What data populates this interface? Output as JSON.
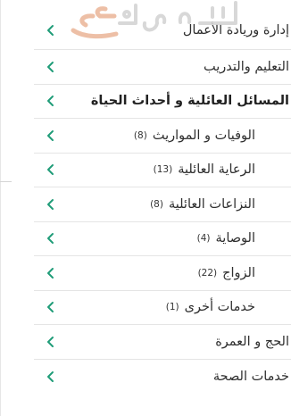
{
  "colors": {
    "chevron": "#1f9c78",
    "divider": "#e5e5e5",
    "text": "#2f2f2f",
    "watermark": "#d2d2d2"
  },
  "watermark_icon": "site-logo-watermark",
  "menu": [
    {
      "label": "إدارة وريادة الأعمال",
      "count": "",
      "level": "top",
      "bold": false
    },
    {
      "label": "التعليم والتدريب",
      "count": "",
      "level": "top",
      "bold": false
    },
    {
      "label": "المسائل العائلية و أحداث الحياة",
      "count": "",
      "level": "top",
      "bold": true
    },
    {
      "label": "الوفيات و المواريث",
      "count": "(8)",
      "level": "sub",
      "bold": false
    },
    {
      "label": "الرعاية العائلية",
      "count": "(13)",
      "level": "sub",
      "bold": false
    },
    {
      "label": "النزاعات العائلية",
      "count": "(8)",
      "level": "sub",
      "bold": false
    },
    {
      "label": "الوصاية",
      "count": "(4)",
      "level": "sub",
      "bold": false
    },
    {
      "label": "الزواج",
      "count": "(22)",
      "level": "sub",
      "bold": false
    },
    {
      "label": "خدمات أخرى",
      "count": "(1)",
      "level": "sub",
      "bold": false
    },
    {
      "label": "الحج و العمرة",
      "count": "",
      "level": "top",
      "bold": false
    },
    {
      "label": "خدمات الصحة",
      "count": "",
      "level": "top",
      "bold": false
    }
  ]
}
